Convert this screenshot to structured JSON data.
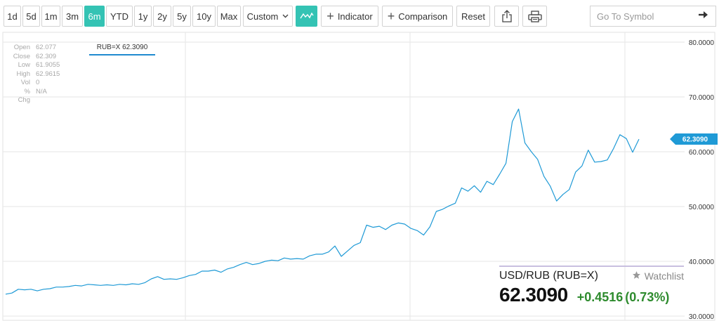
{
  "toolbar": {
    "ranges": [
      {
        "label": "1d",
        "active": false
      },
      {
        "label": "5d",
        "active": false
      },
      {
        "label": "1m",
        "active": false
      },
      {
        "label": "3m",
        "active": false
      },
      {
        "label": "6m",
        "active": true
      },
      {
        "label": "YTD",
        "active": false
      },
      {
        "label": "1y",
        "active": false
      },
      {
        "label": "2y",
        "active": false
      },
      {
        "label": "5y",
        "active": false
      },
      {
        "label": "10y",
        "active": false
      },
      {
        "label": "Max",
        "active": false
      }
    ],
    "custom_label": "Custom",
    "chart_type_icon": "line-chart-icon",
    "indicator_label": "Indicator",
    "comparison_label": "Comparison",
    "reset_label": "Reset",
    "share_icon": "share-icon",
    "print_icon": "print-icon",
    "symbol_placeholder": "Go To Symbol",
    "go_icon": "arrow-right-icon"
  },
  "ohlc": [
    {
      "label": "Open",
      "value": "62.077"
    },
    {
      "label": "Close",
      "value": "62.309"
    },
    {
      "label": "Low",
      "value": "61.9055"
    },
    {
      "label": "High",
      "value": "62.9615"
    },
    {
      "label": "Vol",
      "value": "0"
    },
    {
      "label": "% Chg",
      "value": "N/A"
    }
  ],
  "legend_tag": "RUB=X 62.3090",
  "quote": {
    "pair": "USD/RUB (RUB=X)",
    "watchlist_label": "Watchlist",
    "price": "62.3090",
    "change": "+0.4516",
    "change_pct": "(0.73%)"
  },
  "colors": {
    "accent": "#34c3b4",
    "line": "#1f9ad6",
    "price_tag": "#1f9ad6",
    "positive": "#2e8b2e",
    "grid": "#e6e6e6"
  },
  "chart_data": {
    "type": "line",
    "series": [
      {
        "values": [
          34.0,
          34.2,
          34.9,
          34.8,
          34.9,
          34.6,
          34.9,
          35.0,
          35.3,
          35.3,
          35.4,
          35.6,
          35.5,
          35.8,
          35.7,
          35.6,
          35.7,
          35.6,
          35.8,
          35.7,
          35.9,
          35.8,
          36.1,
          36.8,
          37.2,
          36.7,
          36.8,
          36.7,
          37.0,
          37.4,
          37.6,
          38.2,
          38.2,
          38.4,
          38.0,
          38.6,
          38.9,
          39.4,
          39.8,
          39.4,
          39.6,
          40.0,
          40.2,
          40.1,
          40.6,
          40.4,
          40.5,
          40.4,
          41.0,
          41.3,
          41.3,
          41.7,
          42.8,
          40.9,
          41.9,
          42.9,
          43.4,
          46.6,
          46.2,
          46.4,
          45.8,
          46.6,
          47.0,
          46.8,
          46.0,
          45.6,
          44.8,
          46.3,
          49.1,
          49.5,
          50.1,
          50.6,
          53.4,
          52.8,
          53.8,
          52.6,
          54.6,
          54.0,
          55.9,
          57.9,
          65.5,
          67.8,
          61.6,
          60.0,
          58.6,
          55.5,
          53.7,
          51.0,
          52.2,
          53.1,
          56.3,
          57.4,
          60.3,
          58.1,
          58.2,
          58.5,
          60.6,
          63.1,
          62.4,
          59.9,
          62.3
        ]
      }
    ],
    "ylim": [
      30,
      80
    ],
    "y_ticks": [
      "30.0000",
      "40.0000",
      "50.0000",
      "60.0000",
      "70.0000",
      "80.0000"
    ],
    "last_value_label": "62.3090",
    "grid": true
  }
}
